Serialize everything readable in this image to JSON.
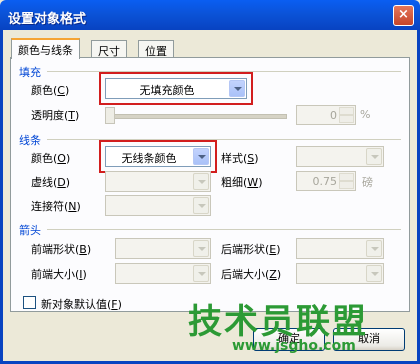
{
  "window": {
    "title": "设置对象格式",
    "close_glyph": "×"
  },
  "tabs": [
    {
      "label": "颜色与线条",
      "active": true
    },
    {
      "label": "尺寸",
      "active": false
    },
    {
      "label": "位置",
      "active": false
    }
  ],
  "fill": {
    "section": "填充",
    "color_label": "颜色(",
    "color_key": "C",
    "color_value": "无填充颜色",
    "transparency_label": "透明度(",
    "transparency_key": "T",
    "transparency_value": "0",
    "percent": "%"
  },
  "line": {
    "section": "线条",
    "color_label": "颜色(",
    "color_key": "O",
    "color_value": "无线条颜色",
    "style_label": "样式(",
    "style_key": "S",
    "dash_label": "虚线(",
    "dash_key": "D",
    "weight_label": "粗细(",
    "weight_key": "W",
    "weight_value": "0.75",
    "weight_unit": "磅",
    "connector_label": "连接符(",
    "connector_key": "N"
  },
  "arrows": {
    "section": "箭头",
    "begin_style_label": "前端形状(",
    "begin_style_key": "B",
    "end_style_label": "后端形状(",
    "end_style_key": "E",
    "begin_size_label": "前端大小(",
    "begin_size_key": "I",
    "end_size_label": "后端大小(",
    "end_size_key": "Z"
  },
  "default_checkbox": {
    "label": "新对象默认值(",
    "key": "F",
    "checked": false
  },
  "buttons": {
    "ok": "确定",
    "cancel": "取消"
  },
  "watermark": {
    "brand": "技术员联盟",
    "url": "www.jsgho.com"
  },
  "colors": {
    "titlebar": "#0b53d8",
    "section_text": "#0046d5",
    "highlight_box": "#d21e1e",
    "watermark": "#2c9a35"
  }
}
